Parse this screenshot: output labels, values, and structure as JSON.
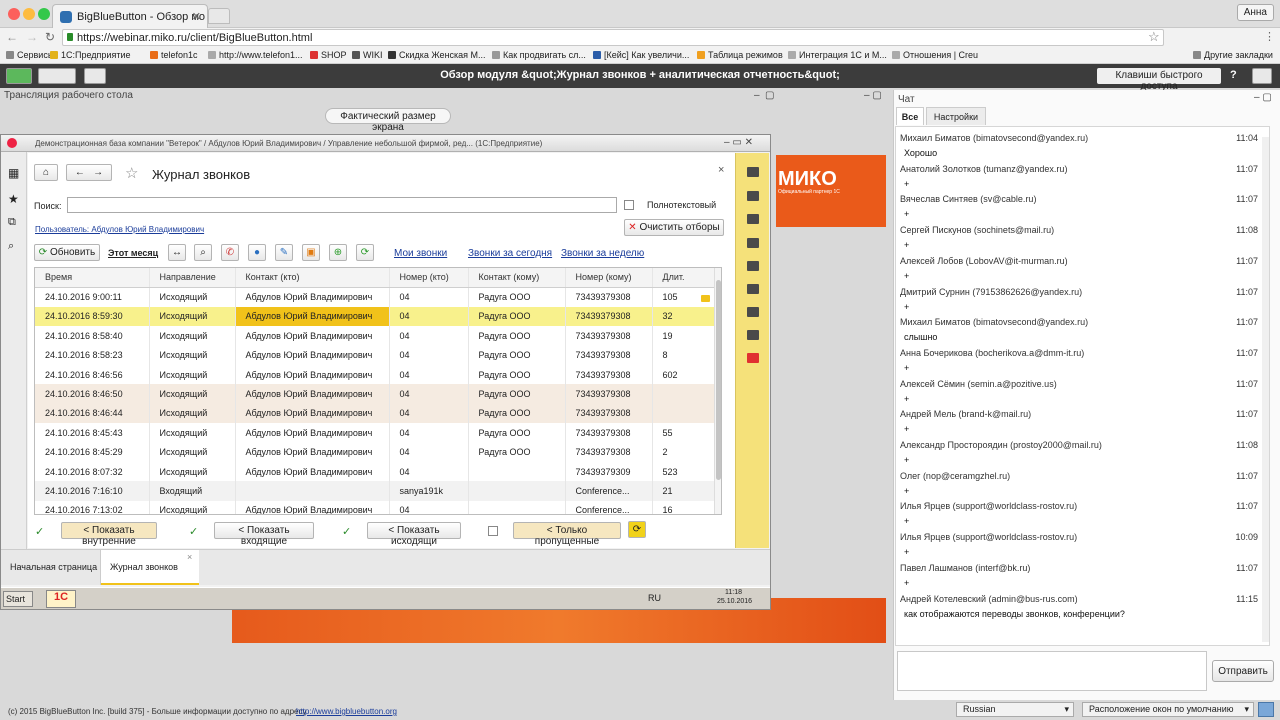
{
  "browser": {
    "tab_title": "BigBlueButton - Обзор мо",
    "user": "Анна",
    "url": "https://webinar.miko.ru/client/BigBlueButton.html",
    "bookmarks": [
      "Сервисы",
      "1С:Предприятие",
      "telefon1c",
      "http://www.telefon1...",
      "SHOP",
      "WIKI",
      "Скидка Женская М...",
      "Как продвигать сл...",
      "[Кейс] Как увеличи...",
      "Таблица режимов",
      "Интеграция 1С и М...",
      "Отношения | Creu",
      "Другие закладки"
    ]
  },
  "bbb": {
    "title": "Обзор модуля &quot;Журнал звонков + аналитическая отчетность&quot;",
    "hotkeys": "Клавиши быстрого доступа",
    "help": "?",
    "desktop_title": "Трансляция рабочего стола",
    "real_size": "Фактический размер экрана",
    "miko_logo": "МИКО",
    "miko_tag": "Официальный партнер 1С"
  },
  "onec": {
    "window_title": "Демонстрационная база компании \"Ветерок\" / Абдулов Юрий Владимирович / Управление небольшой фирмой, ред...  (1С:Предприятие)",
    "form_title": "Журнал звонков",
    "search_label": "Поиск:",
    "fulltext": "Полнотекстовый",
    "clear_filters": "Очистить отборы",
    "user_link": "Пользователь: Абдулов Юрий Владимирович",
    "refresh": "Обновить",
    "this_month": "Этот месяц",
    "my_calls": "Мои звонки",
    "calls_today": "Звонки за сегодня",
    "calls_week": "Звонки за неделю",
    "columns": [
      "Время",
      "Направление",
      "Контакт (кто)",
      "Номер (кто)",
      "Контакт (кому)",
      "Номер (кому)",
      "Длит."
    ],
    "rows": [
      [
        "24.10.2016 9:00:11",
        "Исходящий",
        "Абдулов Юрий Владимирович",
        "04",
        "Радуга ООО",
        "73439379308",
        "105"
      ],
      [
        "24.10.2016 8:59:30",
        "Исходящий",
        "Абдулов Юрий Владимирович",
        "04",
        "Радуга ООО",
        "73439379308",
        "32"
      ],
      [
        "24.10.2016 8:58:40",
        "Исходящий",
        "Абдулов Юрий Владимирович",
        "04",
        "Радуга ООО",
        "73439379308",
        "19"
      ],
      [
        "24.10.2016 8:58:23",
        "Исходящий",
        "Абдулов Юрий Владимирович",
        "04",
        "Радуга ООО",
        "73439379308",
        "8"
      ],
      [
        "24.10.2016 8:46:56",
        "Исходящий",
        "Абдулов Юрий Владимирович",
        "04",
        "Радуга ООО",
        "73439379308",
        "602"
      ],
      [
        "24.10.2016 8:46:50",
        "Исходящий",
        "Абдулов Юрий Владимирович",
        "04",
        "Радуга ООО",
        "73439379308",
        ""
      ],
      [
        "24.10.2016 8:46:44",
        "Исходящий",
        "Абдулов Юрий Владимирович",
        "04",
        "Радуга ООО",
        "73439379308",
        ""
      ],
      [
        "24.10.2016 8:45:43",
        "Исходящий",
        "Абдулов Юрий Владимирович",
        "04",
        "Радуга ООО",
        "73439379308",
        "55"
      ],
      [
        "24.10.2016 8:45:29",
        "Исходящий",
        "Абдулов Юрий Владимирович",
        "04",
        "Радуга ООО",
        "73439379308",
        "2"
      ],
      [
        "24.10.2016 8:07:32",
        "Исходящий",
        "Абдулов Юрий Владимирович",
        "04",
        "",
        "73439379309",
        "523"
      ],
      [
        "24.10.2016 7:16:10",
        "Входящий",
        "",
        "sanya191k",
        "",
        "Conference...",
        "21"
      ],
      [
        "24.10.2016 7:13:02",
        "Исходящий",
        "Абдулов Юрий Владимирович",
        "04",
        "",
        "Conference...",
        "16"
      ]
    ],
    "show_internal": "< Показать внутренние",
    "show_incoming": "< Показать входящие",
    "show_outgoing": "< Показать исходящи",
    "only_missed": "< Только пропущенные",
    "tab_home": "Начальная страница",
    "tab_journal": "Журнал звонков",
    "start": "Start",
    "lang": "RU",
    "clock_time": "11:18",
    "clock_date": "25.10.2016"
  },
  "chat": {
    "title": "Чат",
    "tab_all": "Все",
    "tab_settings": "Настройки",
    "send": "Отправить",
    "messages": [
      {
        "name": "Михаил Биматов (bimatovsecond@yandex.ru)",
        "time": "11:04",
        "text": "Хорошо"
      },
      {
        "name": "Анатолий Золотков (tumanz@yandex.ru)",
        "time": "11:07",
        "text": "+"
      },
      {
        "name": "Вячеслав Синтяев (sv@cable.ru)",
        "time": "11:07",
        "text": "+"
      },
      {
        "name": "Сергей Пискунов (sochinets@mail.ru)",
        "time": "11:08",
        "text": "+"
      },
      {
        "name": "Алексей Лобов (LobovAV@it-murman.ru)",
        "time": "11:07",
        "text": "+"
      },
      {
        "name": "Дмитрий Сурнин (79153862626@yandex.ru)",
        "time": "11:07",
        "text": "+"
      },
      {
        "name": "Михаил Биматов (bimatovsecond@yandex.ru)",
        "time": "11:07",
        "text": "слышно"
      },
      {
        "name": "Анна Бочерикова (bocherikova.a@dmm-it.ru)",
        "time": "11:07",
        "text": "+"
      },
      {
        "name": "Алексей Сёмин (semin.a@pozitive.us)",
        "time": "11:07",
        "text": "+"
      },
      {
        "name": "Андрей Мель (brand-k@mail.ru)",
        "time": "11:07",
        "text": "+"
      },
      {
        "name": "Александр Простороядин (prostoy2000@mail.ru)",
        "time": "11:08",
        "text": "+"
      },
      {
        "name": "Олег (nop@ceramgzhel.ru)",
        "time": "11:07",
        "text": "+"
      },
      {
        "name": "Илья Ярцев (support@worldclass-rostov.ru)",
        "time": "11:07",
        "text": "+"
      },
      {
        "name": "Илья Ярцев (support@worldclass-rostov.ru)",
        "time": "10:09",
        "text": "+"
      },
      {
        "name": "Павел Лашманов (interf@bk.ru)",
        "time": "11:07",
        "text": "+"
      },
      {
        "name": "Андрей Котелевский (admin@bus-rus.com)",
        "time": "11:15",
        "text": "как отображаются переводы звонков, конференции?"
      }
    ]
  },
  "footer": {
    "copyright": "(c) 2015 BigBlueButton Inc. [build 375] - Больше информации доступно по адресу",
    "link": "http://www.bigbluebutton.org",
    "language": "Russian",
    "layout": "Расположение окон по умолчанию"
  }
}
